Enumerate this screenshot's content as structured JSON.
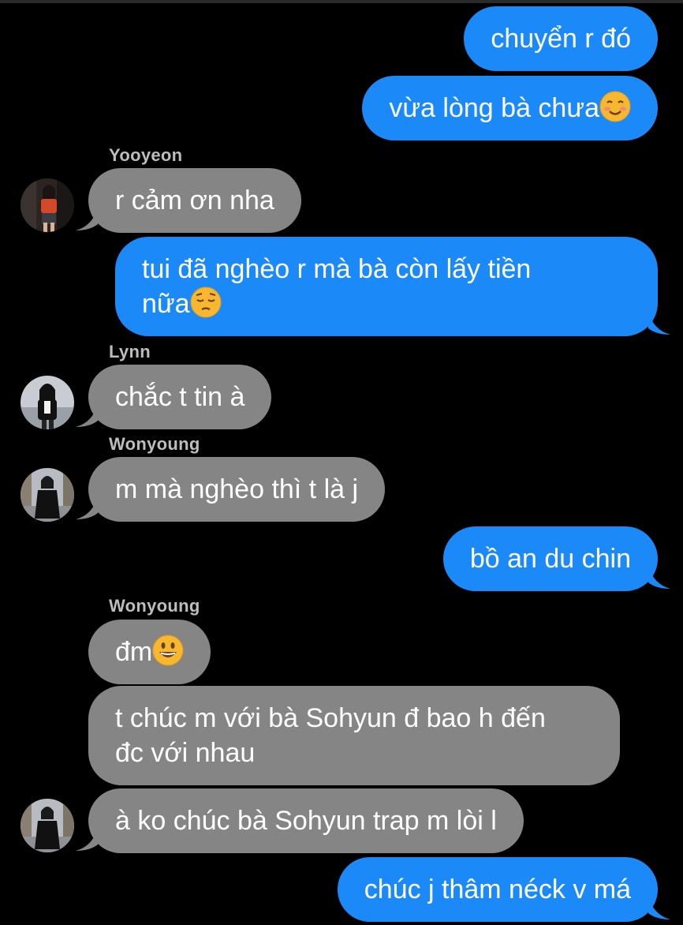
{
  "messages": [
    {
      "id": "m1",
      "direction": "out",
      "text": "chuyển r đó"
    },
    {
      "id": "m2",
      "direction": "out",
      "text": "vừa lòng bà chưa",
      "emoji": "smiling-face-emoji"
    },
    {
      "id": "m3",
      "direction": "in",
      "sender": "Yooyeon",
      "avatar": "yooyeon-avatar",
      "text": "r cảm ơn nha"
    },
    {
      "id": "m4",
      "direction": "out",
      "line1": "tui đã nghèo r mà bà còn lấy tiền",
      "line2": "nữa",
      "emoji": "pensive-face-emoji"
    },
    {
      "id": "m5",
      "direction": "in",
      "sender": "Lynn",
      "avatar": "lynn-avatar",
      "text": "chắc t tin à"
    },
    {
      "id": "m6",
      "direction": "in",
      "sender": "Wonyoung",
      "avatar": "wonyoung-avatar",
      "text": "m mà nghèo thì t là j"
    },
    {
      "id": "m7",
      "direction": "out",
      "text": "bồ an du chin"
    },
    {
      "id": "m8",
      "direction": "in",
      "sender": "Wonyoung",
      "text": "đm",
      "emoji": "grinning-face-emoji"
    },
    {
      "id": "m9",
      "direction": "in",
      "line1": "t chúc m với bà Sohyun đ bao h đến",
      "line2": "đc với nhau"
    },
    {
      "id": "m10",
      "direction": "in",
      "avatar": "wonyoung-avatar",
      "text": "à ko chúc bà Sohyun trap m lòi l"
    },
    {
      "id": "m11",
      "direction": "out",
      "text": "chúc j thâm néck v má"
    }
  ],
  "colors": {
    "background": "#000000",
    "outgoing_bubble": "#1b8af8",
    "incoming_bubble": "#858585",
    "sender_name": "#bdbdbd"
  }
}
